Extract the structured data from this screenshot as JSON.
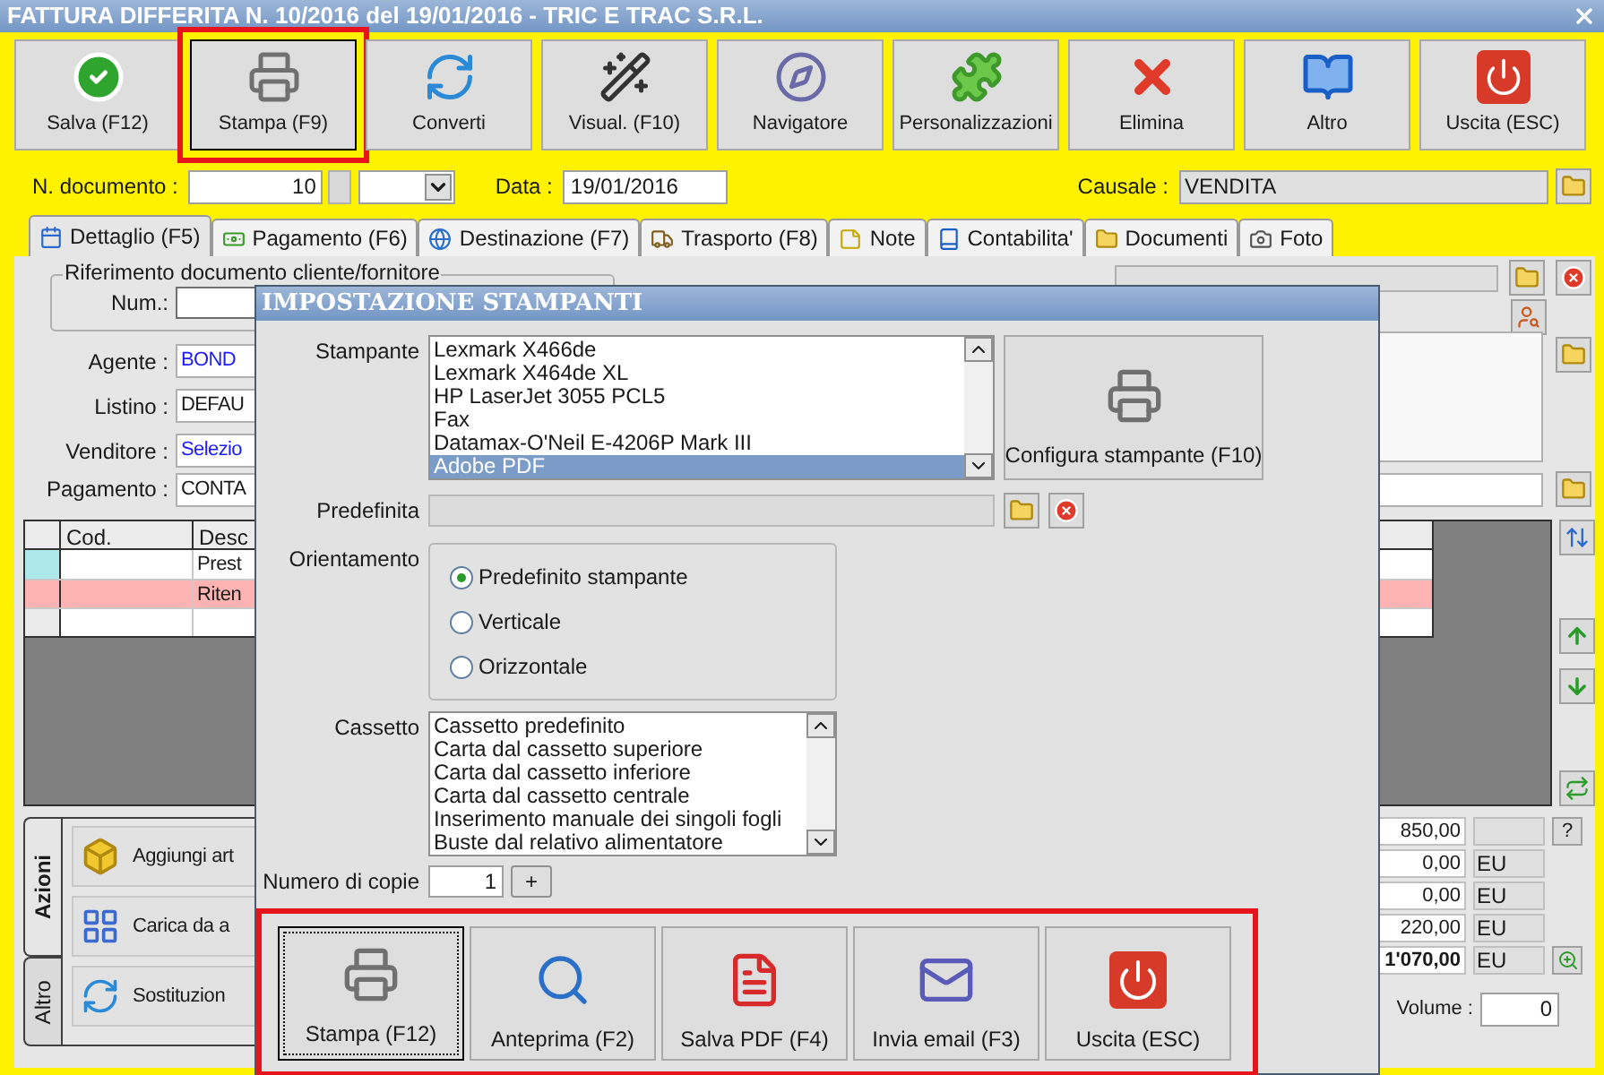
{
  "window": {
    "title": "FATTURA DIFFERITA N. 10/2016 del 19/01/2016 - TRIC E TRAC S.R.L."
  },
  "toolbar": [
    {
      "label": "Salva (F12)",
      "highlighted": false
    },
    {
      "label": "Stampa (F9)",
      "highlighted": true
    },
    {
      "label": "Converti",
      "highlighted": false
    },
    {
      "label": "Visual. (F10)",
      "highlighted": false
    },
    {
      "label": "Navigatore",
      "highlighted": false
    },
    {
      "label": "Personalizzazioni",
      "highlighted": false
    },
    {
      "label": "Elimina",
      "highlighted": false
    },
    {
      "label": "Altro",
      "highlighted": false
    },
    {
      "label": "Uscita (ESC)",
      "highlighted": false
    }
  ],
  "header": {
    "doc_label": "N. documento :",
    "doc_number": "10",
    "date_label": "Data :",
    "date": "19/01/2016",
    "causale_label": "Causale :",
    "causale": "VENDITA"
  },
  "tabs": [
    {
      "label": "Dettaglio (F5)",
      "selected": true
    },
    {
      "label": "Pagamento (F6)",
      "selected": false
    },
    {
      "label": "Destinazione (F7)",
      "selected": false
    },
    {
      "label": "Trasporto (F8)",
      "selected": false
    },
    {
      "label": "Note",
      "selected": false
    },
    {
      "label": "Contabilita'",
      "selected": false
    },
    {
      "label": "Documenti",
      "selected": false
    },
    {
      "label": "Foto",
      "selected": false
    }
  ],
  "reference_group": {
    "legend": "Riferimento documento cliente/fornitore",
    "num_label": "Num.:"
  },
  "fields": [
    {
      "label": "Agente :",
      "value": "BOND",
      "kind": "lookup"
    },
    {
      "label": "Listino :",
      "value": "DEFAU",
      "kind": "text"
    },
    {
      "label": "Venditore :",
      "value": "Selezio",
      "kind": "lookup"
    }
  ],
  "payment": {
    "label": "Pagamento :",
    "value": "CONTA"
  },
  "table": {
    "columns": [
      "Cod.",
      "Desc"
    ],
    "rows": [
      {
        "color": "#aee8ea",
        "highlighted": false,
        "description": "Prest"
      },
      {
        "color": "#ffb3b3",
        "highlighted": true,
        "description": "Riten"
      },
      {
        "color": "#ebebeb",
        "highlighted": false
      }
    ]
  },
  "side_tabs": [
    {
      "label": "Azioni",
      "selected": true
    },
    {
      "label": "Altro",
      "selected": false
    }
  ],
  "actions": [
    "Aggiungi art",
    "Carica da a",
    "Sostituzion"
  ],
  "totals": [
    {
      "value": "850,00",
      "total": false
    },
    {
      "value": "0,00",
      "unit": "EU",
      "total": false
    },
    {
      "value": "0,00",
      "unit": "EU",
      "total": false
    },
    {
      "value": "220,00",
      "unit": "EU",
      "total": false
    },
    {
      "value": "1'070,00",
      "unit": "EU",
      "total": true
    }
  ],
  "help_button": "?",
  "volume": {
    "label": "Volume :",
    "value": "0"
  },
  "dialog": {
    "title": "IMPOSTAZIONE STAMPANTI",
    "printer_label": "Stampante",
    "printers": [
      {
        "name": "Lexmark X466de",
        "selected": false
      },
      {
        "name": "Lexmark X464de XL",
        "selected": false
      },
      {
        "name": "HP LaserJet 3055 PCL5",
        "selected": false
      },
      {
        "name": "Fax",
        "selected": false
      },
      {
        "name": "Datamax-O'Neil E-4206P Mark III",
        "selected": false
      },
      {
        "name": "Adobe PDF",
        "selected": true
      }
    ],
    "configure_button": "Configura stampante (F10)",
    "default_label": "Predefinita",
    "orientation_label": "Orientamento",
    "orientations": [
      {
        "label": "Predefinito stampante",
        "selected": true
      },
      {
        "label": "Verticale",
        "selected": false
      },
      {
        "label": "Orizzontale",
        "selected": false
      }
    ],
    "tray_label": "Cassetto",
    "trays": [
      "Cassetto predefinito",
      "Carta dal cassetto superiore",
      "Carta dal cassetto inferiore",
      "Carta dal cassetto centrale",
      "Inserimento manuale dei singoli fogli",
      "Buste dal relativo alimentatore"
    ],
    "copies_label": "Numero di copie",
    "copies": "1",
    "plus_button": "+",
    "buttons_highlighted": true,
    "buttons": [
      {
        "label": "Stampa (F12)",
        "focused": true
      },
      {
        "label": "Anteprima (F2)",
        "focused": false
      },
      {
        "label": "Salva PDF (F4)",
        "focused": false
      },
      {
        "label": "Invia email (F3)",
        "focused": false
      },
      {
        "label": "Uscita (ESC)",
        "focused": false
      }
    ]
  }
}
